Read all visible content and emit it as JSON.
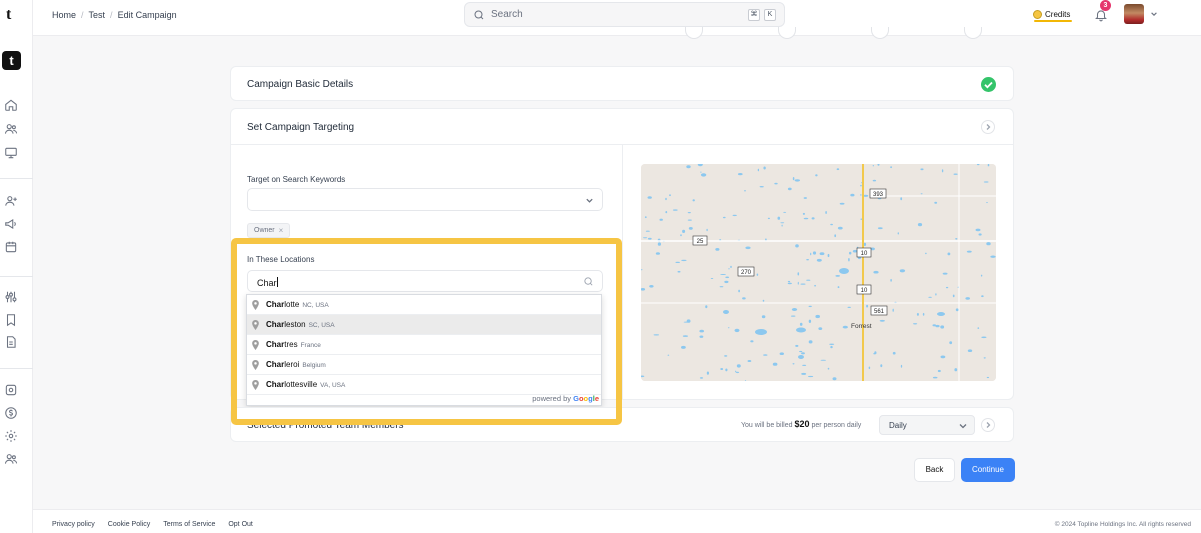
{
  "app": {
    "brand_letter": "t"
  },
  "breadcrumb": [
    "Home",
    "Test",
    "Edit Campaign"
  ],
  "search": {
    "placeholder": "Search",
    "kbd1": "⌘",
    "kbd2": "K"
  },
  "header": {
    "credits_label": "Credits",
    "notifications_count": "3"
  },
  "sections": {
    "basic": {
      "title": "Campaign Basic Details"
    },
    "targeting": {
      "title": "Set Campaign Targeting"
    },
    "team": {
      "title": "Selected Promoted Team Members"
    }
  },
  "keywords": {
    "label": "Target on Search Keywords",
    "value": "",
    "chips": [
      "Owner"
    ]
  },
  "locations": {
    "label": "In These Locations",
    "input_value": "Char",
    "suggestions": [
      {
        "match": "Char",
        "rest": "lotte",
        "secondary": "NC, USA"
      },
      {
        "match": "Char",
        "rest": "leston",
        "secondary": "SC, USA"
      },
      {
        "match": "Char",
        "rest": "tres",
        "secondary": "France"
      },
      {
        "match": "Char",
        "rest": "leroi",
        "secondary": "Belgium"
      },
      {
        "match": "Char",
        "rest": "lottesville",
        "secondary": "VA, USA"
      }
    ],
    "powered_by": "powered by",
    "google": [
      "G",
      "o",
      "o",
      "g",
      "l",
      "e"
    ]
  },
  "map": {
    "road_labels": [
      "393",
      "25",
      "270",
      "10",
      "10",
      "561"
    ],
    "place_label": "Forrest"
  },
  "billing": {
    "prefix": "You will be billed",
    "amount": "$20",
    "suffix": "per person daily",
    "frequency": "Daily"
  },
  "actions": {
    "back": "Back",
    "continue": "Continue"
  },
  "footer": {
    "links": [
      "Privacy policy",
      "Cookie Policy",
      "Terms of Service",
      "Opt Out"
    ],
    "copyright": "© 2024 Topline Holdings Inc. All rights reserved"
  },
  "colors": {
    "accent": "#3b82f6",
    "highlight": "#f6c544",
    "success": "#34c46a",
    "badge": "#e5356c"
  }
}
